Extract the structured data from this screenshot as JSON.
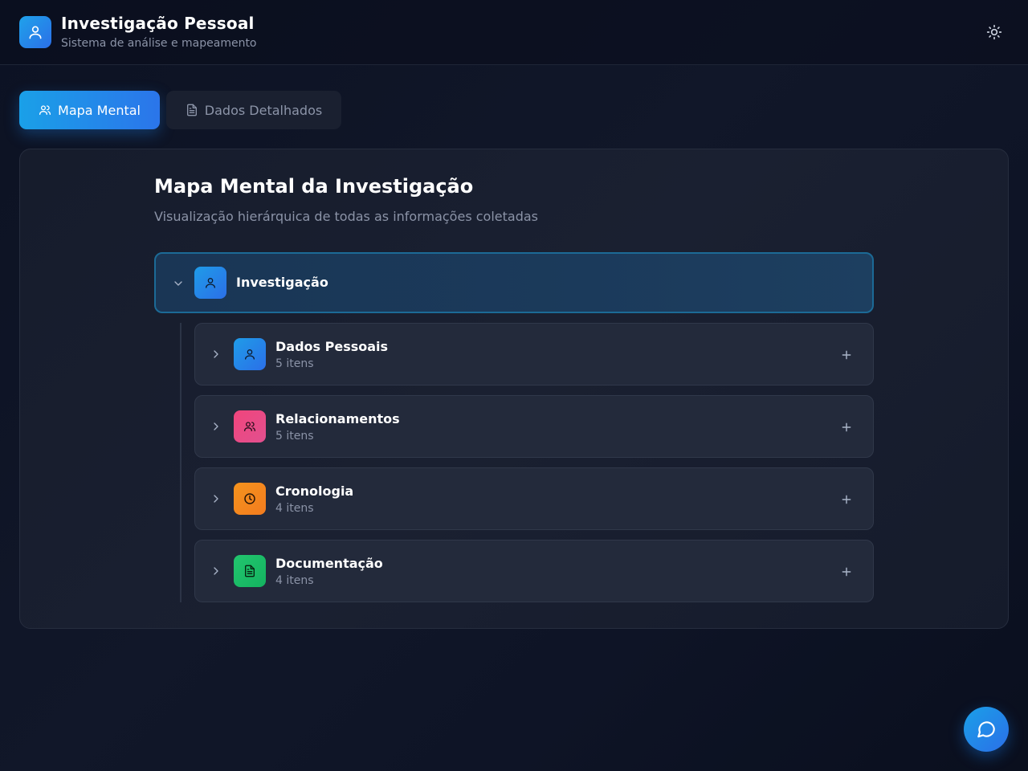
{
  "header": {
    "title": "Investigação Pessoal",
    "subtitle": "Sistema de análise e mapeamento",
    "logo_icon": "user-icon",
    "theme_icon": "sun-icon"
  },
  "tabs": [
    {
      "label": "Mapa Mental",
      "icon": "users-icon",
      "active": true
    },
    {
      "label": "Dados Detalhados",
      "icon": "file-text-icon",
      "active": false
    }
  ],
  "panel": {
    "title": "Mapa Mental da Investigação",
    "subtitle": "Visualização hierárquica de todas as informações coletadas"
  },
  "root": {
    "label": "Investigação",
    "icon": "user-icon",
    "expanded": true
  },
  "children": [
    {
      "label": "Dados Pessoais",
      "count": "5 itens",
      "icon": "user-icon",
      "color": "#2b8fe8"
    },
    {
      "label": "Relacionamentos",
      "count": "5 itens",
      "icon": "users-icon",
      "color": "#ec4b86"
    },
    {
      "label": "Cronologia",
      "count": "4 itens",
      "icon": "clock-icon",
      "color": "#f58a1f"
    },
    {
      "label": "Documentação",
      "count": "4 itens",
      "icon": "file-text-icon",
      "color": "#1fbf6a"
    }
  ],
  "fab": {
    "icon": "chat-bubble-icon"
  },
  "colors": {
    "accent": "#1f9ce8",
    "background": "#0f1526",
    "card": "#232a3b"
  }
}
